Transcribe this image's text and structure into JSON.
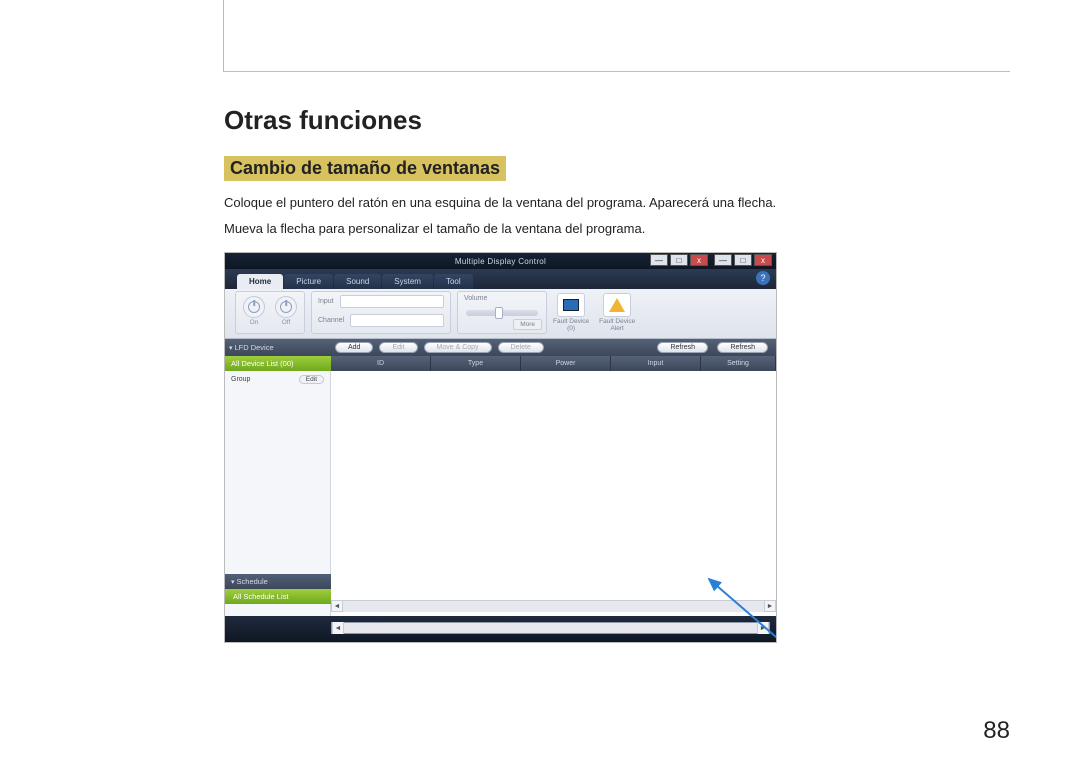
{
  "page_number": "88",
  "headings": {
    "section": "Otras funciones",
    "sub": "Cambio de tamaño de ventanas"
  },
  "paragraphs": {
    "p1": "Coloque el puntero del ratón en una esquina de la ventana del programa. Aparecerá una flecha.",
    "p2": "Mueva la flecha para personalizar el tamaño de la ventana del programa."
  },
  "app": {
    "title": "Multiple Display Control",
    "window_buttons": {
      "min": "—",
      "max": "□",
      "close": "x"
    },
    "tabs": [
      "Home",
      "Picture",
      "Sound",
      "System",
      "Tool"
    ],
    "active_tab": "Home",
    "help_label": "?",
    "ribbon": {
      "power": {
        "on": "On",
        "off": "Off"
      },
      "input_label": "Input",
      "channel_label": "Channel",
      "volume_label": "Volume",
      "more": "More",
      "fault_device_count": "Fault Device\n(0)",
      "fault_device_alert": "Fault Device\nAlert"
    },
    "toolbar": {
      "section": "LFD Device",
      "add": "Add",
      "edit": "Edit",
      "move_copy": "Move & Copy",
      "delete": "Delete",
      "refresh": "Refresh"
    },
    "sidebar": {
      "all_devices": "All Device List (00)",
      "group": "Group",
      "edit": "Edit",
      "schedule": "Schedule",
      "schedule_list": "All Schedule List"
    },
    "columns": [
      "ID",
      "Type",
      "Power",
      "Input",
      "Setting"
    ],
    "refresh2": "Refresh"
  }
}
